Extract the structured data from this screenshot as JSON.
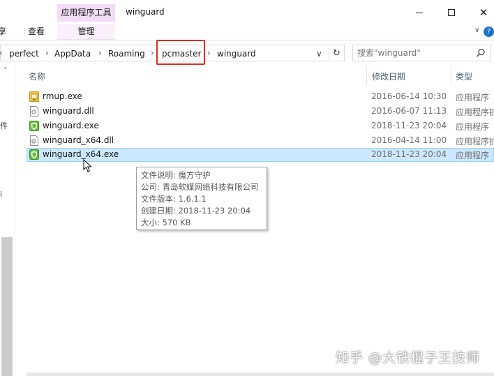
{
  "window": {
    "title": "winguard",
    "context_tab": "应用程序工具"
  },
  "ribbon": {
    "share_fragment": "享",
    "view_tab": "查看",
    "manage_tab": "管理",
    "collapse_glyph": "∨",
    "help_glyph": "?"
  },
  "address": {
    "back_fragment": "‹",
    "crumbs": [
      "perfect",
      "AppData",
      "Roaming",
      "pcmaster",
      "winguard"
    ],
    "separator": "›",
    "dropdown_glyph": "∨",
    "refresh_glyph": "↻"
  },
  "search": {
    "placeholder": "搜索\"winguard\""
  },
  "nav": {
    "fragments": [
      "件",
      "i"
    ]
  },
  "columns": {
    "name": "名称",
    "modified": "修改日期",
    "type": "类型"
  },
  "files": [
    {
      "name": "rmup.exe",
      "modified": "2016-06-14 10:30",
      "type": "应用程序",
      "icon": "installer-icon"
    },
    {
      "name": "winguard.dll",
      "modified": "2016-06-07 11:13",
      "type": "应用程序扩",
      "icon": "dll-file-icon"
    },
    {
      "name": "winguard.exe",
      "modified": "2018-11-23 20:04",
      "type": "应用程序",
      "icon": "shield-app-icon"
    },
    {
      "name": "winguard_x64.dll",
      "modified": "2016-04-14 11:00",
      "type": "应用程序扩",
      "icon": "dll-file-icon"
    },
    {
      "name": "winguard_x64.exe",
      "modified": "2018-11-23 20:04",
      "type": "应用程序",
      "icon": "shield-app-icon",
      "selected": true
    }
  ],
  "tooltip": {
    "lines": [
      "文件说明: 魔方守护",
      "公司: 青岛软媒网络科技有限公司",
      "文件版本: 1.6.1.1",
      "创建日期: 2018-11-23 20:04",
      "大小: 570 KB"
    ]
  },
  "watermark": "知乎 @大铁棍子王技师",
  "colors": {
    "context_tab": "#f3dcf5",
    "selection": "#cce8ff",
    "selection_border": "#99d1ff",
    "highlight_box": "#e52a17",
    "header_text": "#4c607a"
  }
}
